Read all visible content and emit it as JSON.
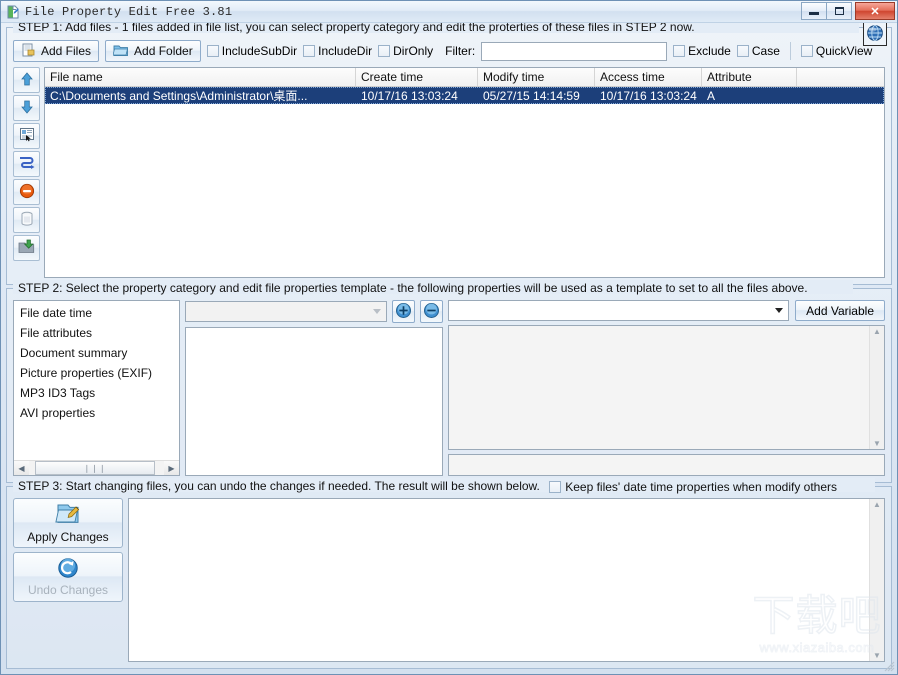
{
  "window": {
    "title": "File Property Edit Free 3.81",
    "icon": "app-file-property-icon",
    "minimize_label": "–",
    "maximize_label": "□",
    "close_label": "✕"
  },
  "step1": {
    "legend": "STEP 1: Add files - 1 files added in file list, you can select property category and edit the proterties of these files in STEP 2 now.",
    "buttons": {
      "add_files": "Add Files",
      "add_folder": "Add Folder"
    },
    "checkboxes": [
      {
        "name": "include-sub-dir",
        "label": "IncludeSubDir",
        "checked": false
      },
      {
        "name": "include-dir",
        "label": "IncludeDir",
        "checked": false
      },
      {
        "name": "dir-only",
        "label": "DirOnly",
        "checked": false
      }
    ],
    "filter": {
      "label": "Filter:",
      "value": "",
      "placeholder": ""
    },
    "filter_checkboxes": [
      {
        "name": "exclude",
        "label": "Exclude",
        "checked": false
      },
      {
        "name": "case",
        "label": "Case",
        "checked": false
      },
      {
        "name": "quickview",
        "label": "QuickView",
        "checked": false
      }
    ],
    "globe_button": "globe-icon",
    "side_tools": [
      "move-up-icon",
      "move-down-icon",
      "select-list-icon",
      "filter-funnel-icon",
      "remove-item-icon",
      "clear-list-icon",
      "save-list-icon"
    ],
    "file_list": {
      "columns": [
        "File name",
        "Create time",
        "Modify time",
        "Access time",
        "Attribute"
      ],
      "rows": [
        {
          "file_name": "C:\\Documents and Settings\\Administrator\\桌面...",
          "create_time": "10/17/16 13:03:24",
          "modify_time": "05/27/15 14:14:59",
          "access_time": "10/17/16 13:03:24",
          "attribute": "A",
          "selected": true
        }
      ]
    }
  },
  "step2": {
    "legend": "STEP 2: Select the property category and edit file properties template - the following properties will be used as a template to set to all the files above.",
    "categories": [
      {
        "label": "File date time",
        "selected": false
      },
      {
        "label": "File attributes",
        "selected": false
      },
      {
        "label": "Document summary",
        "selected": false
      },
      {
        "label": "Picture properties (EXIF)",
        "selected": false
      },
      {
        "label": "MP3 ID3 Tags",
        "selected": false
      },
      {
        "label": "AVI properties",
        "selected": false
      }
    ],
    "property_combo": {
      "value": "",
      "enabled": false
    },
    "add_property_button": "plus-circle-icon",
    "remove_property_button": "minus-circle-icon",
    "variable_combo": {
      "value": "",
      "enabled": true
    },
    "add_variable_button": "Add Variable",
    "category_hscroll_thumb": "❘❘❘"
  },
  "step3": {
    "legend": "STEP 3: Start changing files, you can undo the changes if needed. The result will be shown below.",
    "keep_datetime": {
      "label": "Keep files' date time properties when modify others",
      "checked": false
    },
    "apply_button": {
      "label": "Apply Changes",
      "icon": "apply-folder-pencil-icon",
      "enabled": true
    },
    "undo_button": {
      "label": "Undo Changes",
      "icon": "undo-arrow-icon",
      "enabled": false
    },
    "output": ""
  },
  "watermark": {
    "text_cn": "下载吧",
    "url": "www.xiazaiba.com"
  },
  "colors": {
    "selection_blue": "#1c3f7a",
    "frame_border": "#6e91b5",
    "close_red": "#cf4630",
    "accent_blue": "#3a7bc8"
  }
}
